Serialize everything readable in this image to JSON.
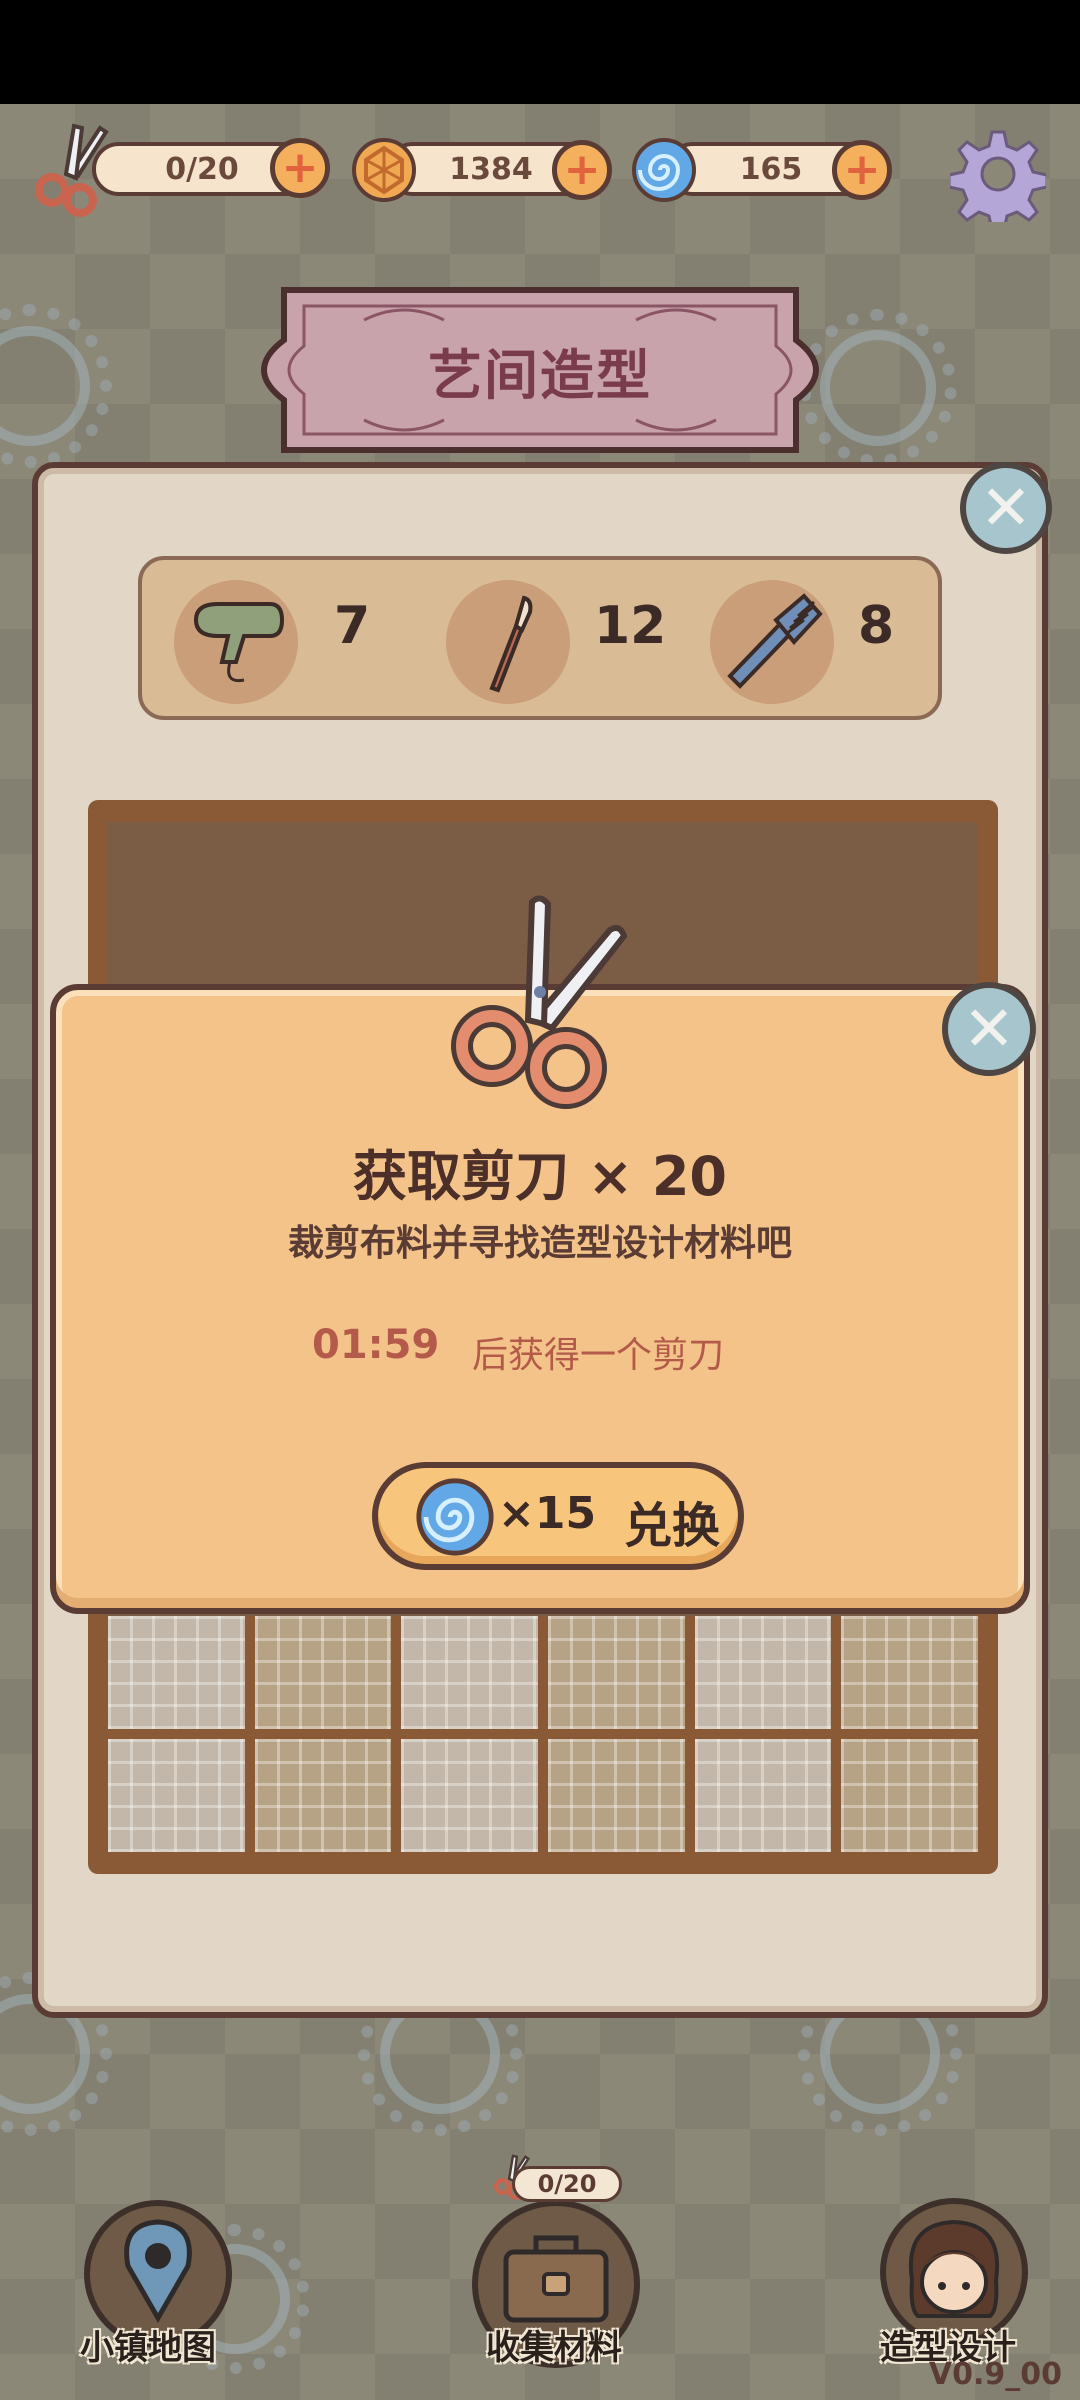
{
  "resources": {
    "scissors_count": "0/20",
    "coins": "1384",
    "gems": "165"
  },
  "title": "艺间造型",
  "tools": [
    {
      "icon": "hair-dryer-icon",
      "count": "7"
    },
    {
      "icon": "makeup-brush-icon",
      "count": "12"
    },
    {
      "icon": "comb-icon",
      "count": "8"
    }
  ],
  "popup": {
    "title": "获取剪刀 × 20",
    "description": "裁剪布料并寻找造型设计材料吧",
    "timer": "01:59",
    "timer_suffix": "后获得一个剪刀",
    "cost": "×15",
    "exchange_label": "兑换"
  },
  "nav": {
    "map_label": "小镇地图",
    "collect_label": "收集材料",
    "collect_badge": "0/20",
    "design_label": "造型设计"
  },
  "version": "V0.9_00",
  "colors": {
    "panel": "#e2d7c7",
    "popup": "#f3c38a",
    "accent": "#f4b05c",
    "outline": "#5b3c34"
  }
}
